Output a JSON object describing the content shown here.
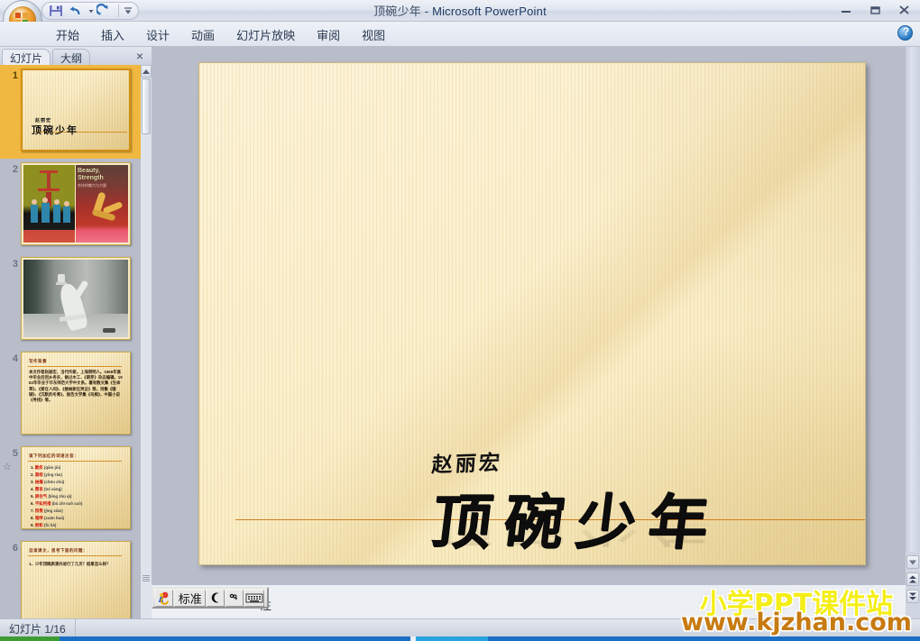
{
  "window": {
    "doc_title": "顶碗少年",
    "app_name": "Microsoft PowerPoint",
    "separator": " - ",
    "minimize_label": "最小化",
    "restore_label": "向下还原",
    "close_label": "关闭",
    "help_label": "?"
  },
  "quick_access": {
    "office_button": "Office 按钮",
    "items": [
      {
        "name": "save-icon",
        "label": "保存"
      },
      {
        "name": "undo-icon",
        "label": "撤消"
      },
      {
        "name": "redo-icon",
        "label": "恢复"
      },
      {
        "name": "customize-qat-icon",
        "label": "自定义快速访问工具栏"
      }
    ]
  },
  "ribbon": {
    "tabs": [
      {
        "label": "开始",
        "active": false
      },
      {
        "label": "插入",
        "active": false
      },
      {
        "label": "设计",
        "active": false
      },
      {
        "label": "动画",
        "active": false
      },
      {
        "label": "幻灯片放映",
        "active": false
      },
      {
        "label": "审阅",
        "active": false
      },
      {
        "label": "视图",
        "active": false
      }
    ]
  },
  "left_pane": {
    "tab_slides": "幻灯片",
    "tab_outline": "大纲",
    "close_label": "×",
    "anim_star": "☆",
    "slides": [
      {
        "number": "1",
        "type": "title",
        "selected": true,
        "author": "赵丽宏",
        "title": "顶碗少年",
        "has_animation": false
      },
      {
        "number": "2",
        "type": "image",
        "selected": false,
        "caption_main": "Beauty,",
        "caption_second": "Strength",
        "caption_sub": "杂技的魅力与力量",
        "has_animation": false
      },
      {
        "number": "3",
        "type": "image",
        "selected": false,
        "has_animation": false
      },
      {
        "number": "4",
        "type": "text",
        "selected": false,
        "heading": "写作背景",
        "body": "本文作者赵丽宏，当代作家。上海崇明人。1968年高中毕业后回乡务农，做过木工、《萌芽》杂志编辑。1982年毕业于华东师范大学中文系。著有散文集《生命草》、《爱在人间》、《维纳斯在哭泣》等，诗集《珊瑚》、《沉默的冬青》，报告文学集《鸟痴》，中篇小说《寻找》等。",
        "has_animation": false
      },
      {
        "number": "5",
        "type": "list",
        "selected": false,
        "heading": "读下列加红的词语注音：",
        "items": [
          {
            "n": "1.",
            "word": "歉疚",
            "pinyin": "(qiàn jiù)"
          },
          {
            "n": "2.",
            "word": "萦绕",
            "pinyin": "(yíng rào)"
          },
          {
            "n": "3.",
            "word": "抽搐",
            "pinyin": "(chōu chù)"
          },
          {
            "n": "4.",
            "word": "颓丧",
            "pinyin": "(tuí sàng)"
          },
          {
            "n": "5.",
            "word": "屏住气",
            "pinyin": "(bǐng zhù qì)"
          },
          {
            "n": "6.",
            "word": "不知所措",
            "pinyin": "(bù zhī suǒ cuò)"
          },
          {
            "n": "7.",
            "word": "惊羡",
            "pinyin": "(jīng xiàn)"
          },
          {
            "n": "8.",
            "word": "喧哗",
            "pinyin": "(xuān huá)"
          },
          {
            "n": "9.",
            "word": "附和",
            "pinyin": "(fù hè)"
          }
        ],
        "has_animation": true
      },
      {
        "number": "6",
        "type": "text",
        "selected": false,
        "heading": "自读课文，思考下面的问题：",
        "body": "1、少年顶碗表演共进行了几次？结果怎么样？",
        "has_animation": false
      }
    ]
  },
  "slide": {
    "author": "赵丽宏",
    "title": "顶碗少年",
    "background_color": "#fbf1d2",
    "rule_color": "#d07f1e"
  },
  "notes": {
    "placeholder_visible": "注"
  },
  "ime_toolbar": {
    "logo": "智能ABC",
    "mode": "标准",
    "moon_icon": "●",
    "punctuation_icon": "°,",
    "keyboard_icon": "▤"
  },
  "status_bar": {
    "slide_counter": "幻灯片 1/16"
  },
  "scrollbars": {
    "prev_slide": "▲",
    "next_slide": "▼",
    "scroll_down": "▼",
    "scroll_up": "▲"
  },
  "watermark": {
    "line1": "小学PPT课件站",
    "line2": "www.kjzhan.com",
    "color1": "#f5ee17",
    "color2": "#c77a10"
  }
}
